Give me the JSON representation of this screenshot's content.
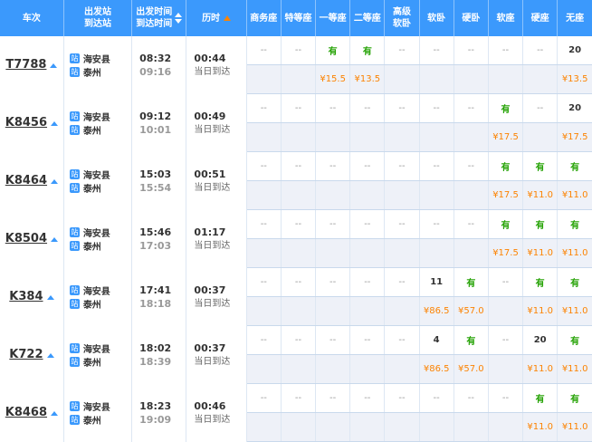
{
  "header": {
    "train_no": "车次",
    "departure_station": "出发站",
    "arrival_station": "到达站",
    "departure_time": "出发时间",
    "arrival_time": "到达时间",
    "duration": "历时",
    "seats": [
      "商务座",
      "特等座",
      "一等座",
      "二等座",
      "高级软卧",
      "软卧",
      "硬卧",
      "软座",
      "硬座",
      "无座"
    ]
  },
  "colors": {
    "header_bg": "#3b99fc",
    "available": "#26a306",
    "price": "#fc8302",
    "price_row_bg": "#eef1f8"
  },
  "icons": {
    "station_icon": "train-station-icon",
    "toggle_icon": "triangle-up-icon"
  },
  "station_icon_glyph": "站",
  "trains": [
    {
      "train_no": "T7788",
      "from": "海安县",
      "to": "泰州",
      "depart": "08:32",
      "arrive": "09:16",
      "duration": "00:44",
      "arrival_note": "当日到达",
      "seats": [
        "--",
        "--",
        "有",
        "有",
        "--",
        "--",
        "--",
        "--",
        "--",
        "20"
      ],
      "prices": [
        "",
        "",
        "¥15.5",
        "¥13.5",
        "",
        "",
        "",
        "",
        "",
        "¥13.5"
      ]
    },
    {
      "train_no": "K8456",
      "from": "海安县",
      "to": "泰州",
      "depart": "09:12",
      "arrive": "10:01",
      "duration": "00:49",
      "arrival_note": "当日到达",
      "seats": [
        "--",
        "--",
        "--",
        "--",
        "--",
        "--",
        "--",
        "有",
        "--",
        "20"
      ],
      "prices": [
        "",
        "",
        "",
        "",
        "",
        "",
        "",
        "¥17.5",
        "",
        "¥17.5"
      ]
    },
    {
      "train_no": "K8464",
      "from": "海安县",
      "to": "泰州",
      "depart": "15:03",
      "arrive": "15:54",
      "duration": "00:51",
      "arrival_note": "当日到达",
      "seats": [
        "--",
        "--",
        "--",
        "--",
        "--",
        "--",
        "--",
        "有",
        "有",
        "有"
      ],
      "prices": [
        "",
        "",
        "",
        "",
        "",
        "",
        "",
        "¥17.5",
        "¥11.0",
        "¥11.0"
      ]
    },
    {
      "train_no": "K8504",
      "from": "海安县",
      "to": "泰州",
      "depart": "15:46",
      "arrive": "17:03",
      "duration": "01:17",
      "arrival_note": "当日到达",
      "seats": [
        "--",
        "--",
        "--",
        "--",
        "--",
        "--",
        "--",
        "有",
        "有",
        "有"
      ],
      "prices": [
        "",
        "",
        "",
        "",
        "",
        "",
        "",
        "¥17.5",
        "¥11.0",
        "¥11.0"
      ]
    },
    {
      "train_no": "K384",
      "from": "海安县",
      "to": "泰州",
      "depart": "17:41",
      "arrive": "18:18",
      "duration": "00:37",
      "arrival_note": "当日到达",
      "seats": [
        "--",
        "--",
        "--",
        "--",
        "--",
        "11",
        "有",
        "--",
        "有",
        "有"
      ],
      "prices": [
        "",
        "",
        "",
        "",
        "",
        "¥86.5",
        "¥57.0",
        "",
        "¥11.0",
        "¥11.0"
      ]
    },
    {
      "train_no": "K722",
      "from": "海安县",
      "to": "泰州",
      "depart": "18:02",
      "arrive": "18:39",
      "duration": "00:37",
      "arrival_note": "当日到达",
      "seats": [
        "--",
        "--",
        "--",
        "--",
        "--",
        "4",
        "有",
        "--",
        "20",
        "有"
      ],
      "prices": [
        "",
        "",
        "",
        "",
        "",
        "¥86.5",
        "¥57.0",
        "",
        "¥11.0",
        "¥11.0"
      ]
    },
    {
      "train_no": "K8468",
      "from": "海安县",
      "to": "泰州",
      "depart": "18:23",
      "arrive": "19:09",
      "duration": "00:46",
      "arrival_note": "当日到达",
      "seats": [
        "--",
        "--",
        "--",
        "--",
        "--",
        "--",
        "--",
        "--",
        "有",
        "有"
      ],
      "prices": [
        "",
        "",
        "",
        "",
        "",
        "",
        "",
        "",
        "¥11.0",
        "¥11.0"
      ]
    }
  ]
}
